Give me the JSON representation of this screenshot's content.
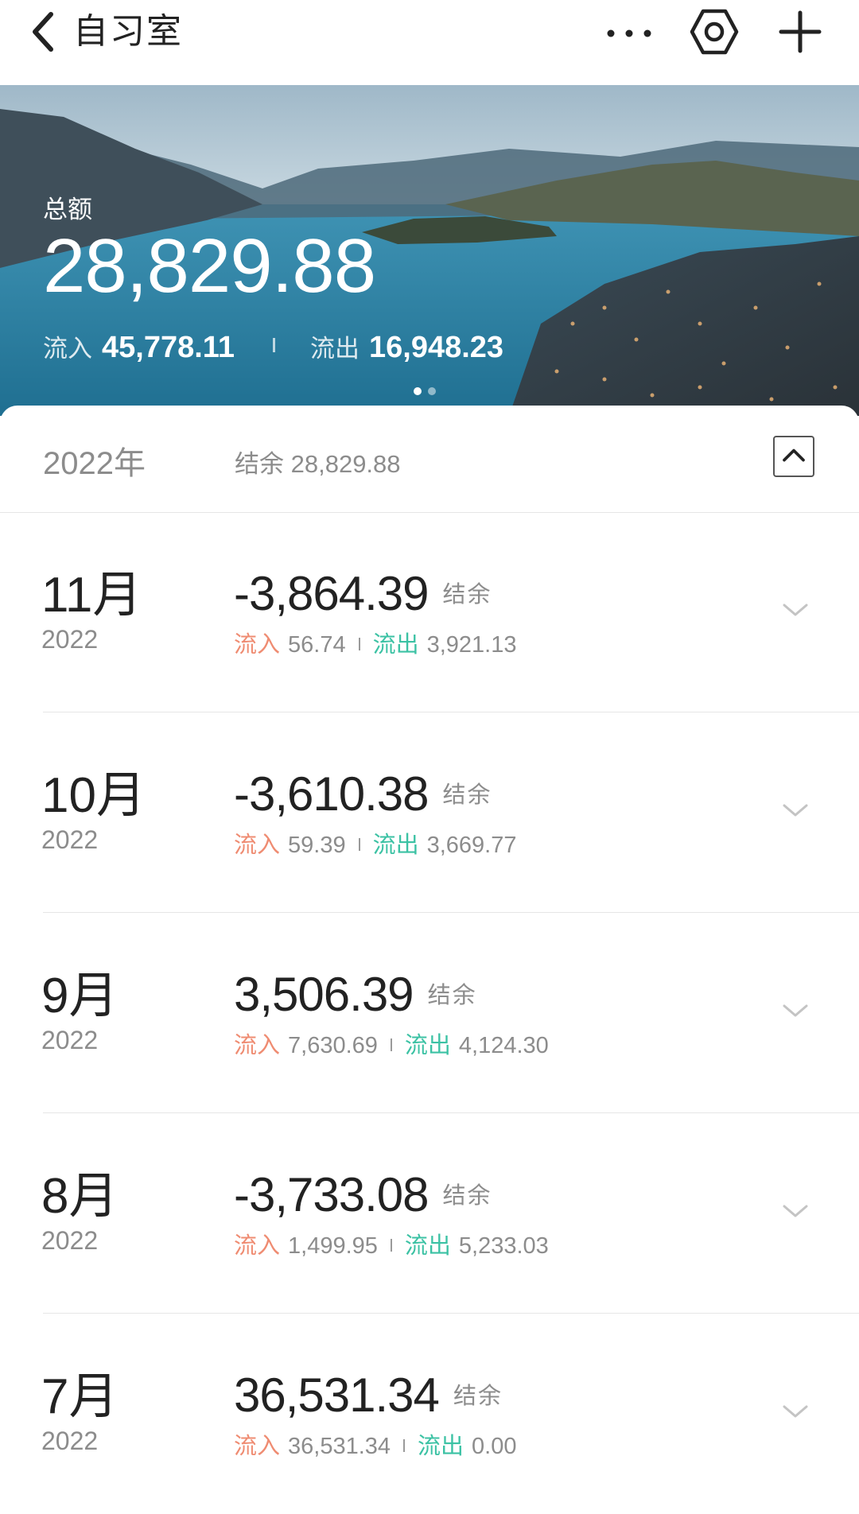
{
  "header": {
    "title": "自习室",
    "icons": [
      "back-arrow-icon",
      "more-icon",
      "settings-hexagon-icon",
      "add-icon"
    ]
  },
  "hero": {
    "total_label": "总额",
    "total_value": "28,829.88",
    "inflow_label": "流入",
    "inflow_value": "45,778.11",
    "outflow_label": "流出",
    "outflow_value": "16,948.23",
    "carousel_page": 1,
    "carousel_count": 2
  },
  "year_summary": {
    "year": "2022年",
    "balance_label": "结余 28,829.88"
  },
  "colors": {
    "inflow": "#ef8c72",
    "outflow": "#3cc2a4",
    "text_primary": "#222222",
    "text_secondary": "#8c8c8c"
  },
  "months": [
    {
      "month": "11月",
      "year": "2022",
      "amount": "-3,864.39",
      "balance_label": "结余",
      "in_label": "流入",
      "in_value": "56.74",
      "out_label": "流出",
      "out_value": "3,921.13"
    },
    {
      "month": "10月",
      "year": "2022",
      "amount": "-3,610.38",
      "balance_label": "结余",
      "in_label": "流入",
      "in_value": "59.39",
      "out_label": "流出",
      "out_value": "3,669.77"
    },
    {
      "month": "9月",
      "year": "2022",
      "amount": "3,506.39",
      "balance_label": "结余",
      "in_label": "流入",
      "in_value": "7,630.69",
      "out_label": "流出",
      "out_value": "4,124.30"
    },
    {
      "month": "8月",
      "year": "2022",
      "amount": "-3,733.08",
      "balance_label": "结余",
      "in_label": "流入",
      "in_value": "1,499.95",
      "out_label": "流出",
      "out_value": "5,233.03"
    },
    {
      "month": "7月",
      "year": "2022",
      "amount": "36,531.34",
      "balance_label": "结余",
      "in_label": "流入",
      "in_value": "36,531.34",
      "out_label": "流出",
      "out_value": "0.00"
    }
  ]
}
